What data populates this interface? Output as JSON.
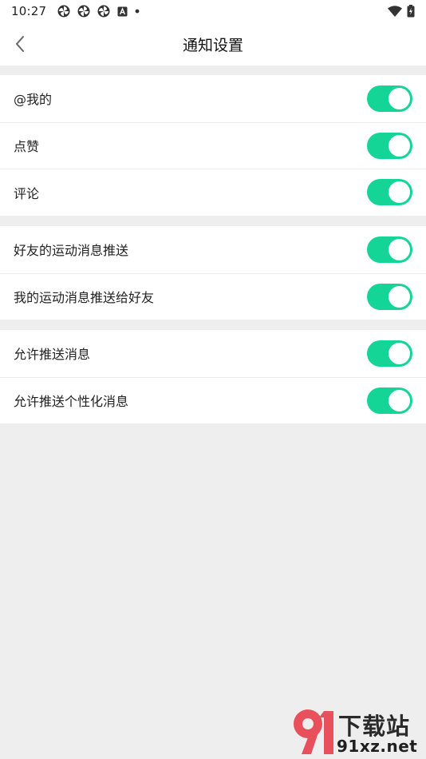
{
  "status_bar": {
    "time": "10:27",
    "icons": [
      "pinwheel-icon",
      "pinwheel-icon",
      "pinwheel-icon",
      "a-box-icon",
      "dot-icon"
    ],
    "right_icons": [
      "wifi-icon",
      "battery-icon"
    ]
  },
  "header": {
    "title": "通知设置",
    "back_icon": "chevron-left-icon"
  },
  "groups": [
    {
      "rows": [
        {
          "label": "@我的",
          "enabled": true
        },
        {
          "label": "点赞",
          "enabled": true
        },
        {
          "label": "评论",
          "enabled": true
        }
      ]
    },
    {
      "rows": [
        {
          "label": "好友的运动消息推送",
          "enabled": true
        },
        {
          "label": "我的运动消息推送给好友",
          "enabled": true
        }
      ]
    },
    {
      "rows": [
        {
          "label": "允许推送消息",
          "enabled": true
        },
        {
          "label": "允许推送个性化消息",
          "enabled": true
        }
      ]
    }
  ],
  "watermark": {
    "logo_text": "9",
    "top_text": "下载站",
    "bottom_text": "91xz.net"
  },
  "colors": {
    "toggle_on": "#14d496",
    "background": "#eeeeee",
    "watermark_red": "#e8505b"
  }
}
